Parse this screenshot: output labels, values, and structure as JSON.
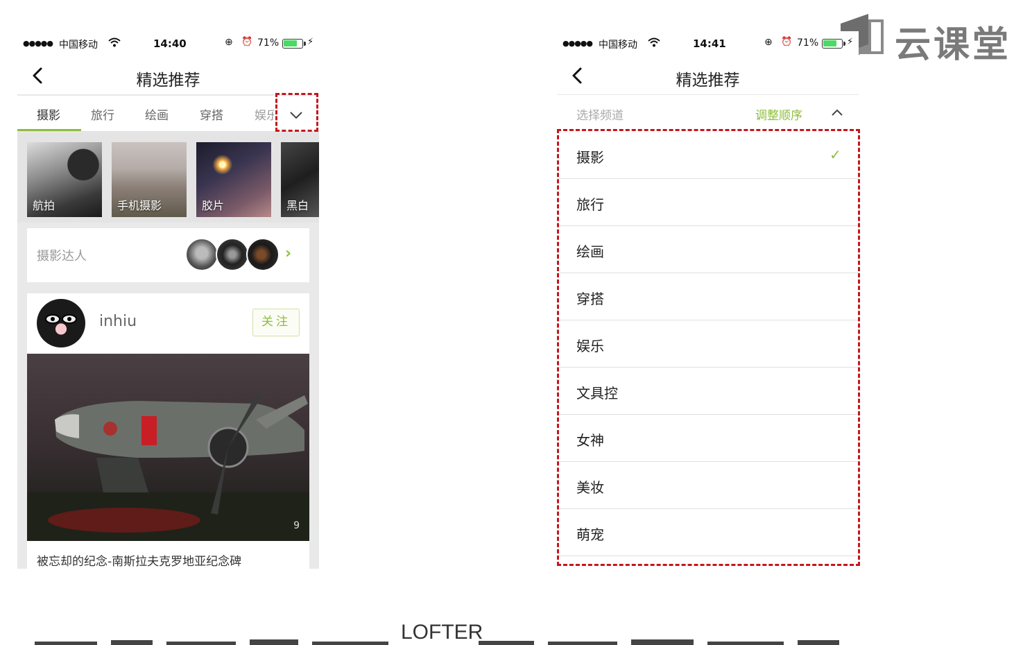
{
  "watermark": {
    "brand": "云课堂"
  },
  "footer": {
    "label": "LOFTER"
  },
  "left_phone": {
    "status": {
      "carrier": "中国移动",
      "time": "14:40",
      "battery": "71%"
    },
    "nav": {
      "title": "精选推荐"
    },
    "tabs": [
      "摄影",
      "旅行",
      "绘画",
      "穿搭",
      "娱乐"
    ],
    "active_tab": "摄影",
    "categories": [
      "航拍",
      "手机摄影",
      "胶片",
      "黑白"
    ],
    "experts": {
      "label": "摄影达人"
    },
    "post": {
      "username": "inhiu",
      "follow_label": "关注",
      "photo_count": "9",
      "caption": "被忘却的纪念-南斯拉夫克罗地亚纪念碑"
    }
  },
  "right_phone": {
    "status": {
      "carrier": "中国移动",
      "time": "14:41",
      "battery": "71%"
    },
    "nav": {
      "title": "精选推荐"
    },
    "channel_header": {
      "label": "选择频道",
      "reorder": "调整顺序"
    },
    "channels": [
      "摄影",
      "旅行",
      "绘画",
      "穿搭",
      "娱乐",
      "文具控",
      "女神",
      "美妆",
      "萌宠"
    ],
    "checked_channel": "摄影"
  },
  "colors": {
    "accent": "#8ebd3c",
    "highlight": "#c4161c"
  },
  "icons": [
    "back-chevron-icon",
    "chevron-down-icon",
    "chevron-up-icon",
    "check-icon",
    "chevron-right-icon",
    "wifi-icon",
    "alarm-icon",
    "orientation-lock-icon",
    "battery-icon"
  ]
}
